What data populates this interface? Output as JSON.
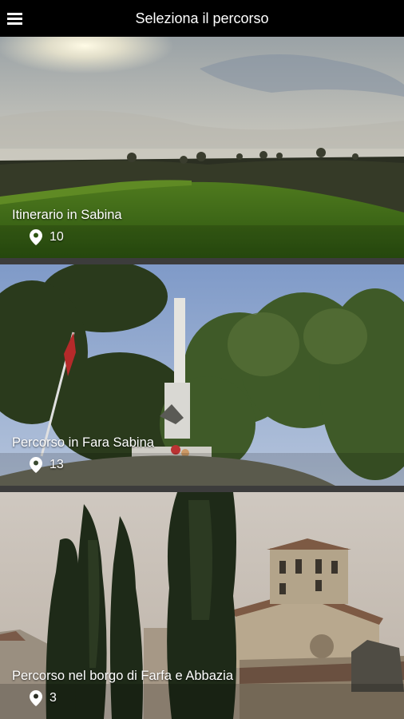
{
  "header": {
    "title": "Seleziona il percorso",
    "menu_icon": "hamburger-menu-icon"
  },
  "routes": [
    {
      "name": "Itinerario in Sabina",
      "count": "10",
      "icon": "location-pin-icon"
    },
    {
      "name": "Percorso in Fara Sabina",
      "count": "13",
      "icon": "location-pin-icon"
    },
    {
      "name": "Percorso nel borgo di Farfa e Abbazia",
      "count": "3",
      "icon": "location-pin-icon"
    }
  ]
}
